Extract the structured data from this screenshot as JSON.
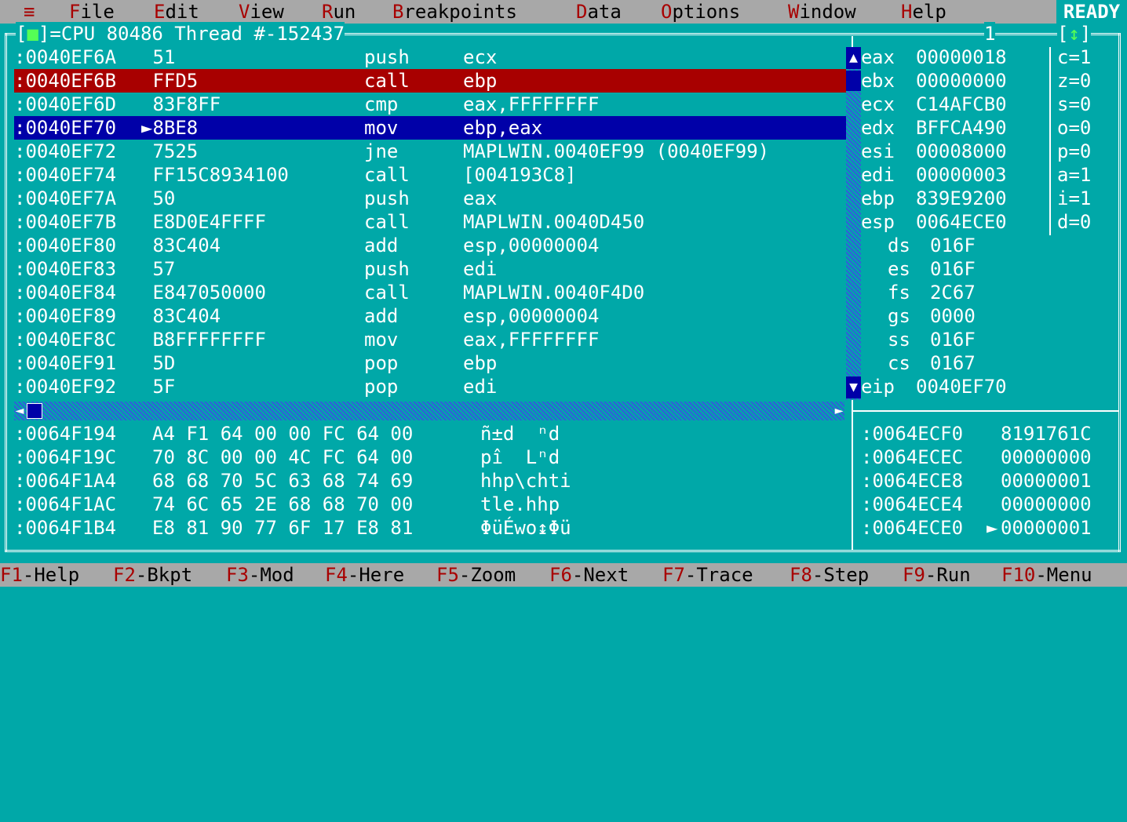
{
  "menu": {
    "system_icon": "≡",
    "items": [
      {
        "hot": "F",
        "rest": "ile"
      },
      {
        "hot": "E",
        "rest": "dit"
      },
      {
        "hot": "V",
        "rest": "iew"
      },
      {
        "hot": "R",
        "rest": "un"
      },
      {
        "hot": "B",
        "rest": "reakpoints"
      },
      {
        "hot": "D",
        "rest": "ata"
      },
      {
        "hot": "O",
        "rest": "ptions"
      },
      {
        "hot": "W",
        "rest": "indow"
      },
      {
        "hot": "H",
        "rest": "elp"
      }
    ],
    "status": "READY"
  },
  "window": {
    "close_box": "■",
    "title": "CPU 80486 Thread #-152437",
    "number": "1",
    "zoom_icon": "↕"
  },
  "code": [
    {
      "addr": ":0040EF6A",
      "bytes": " 51",
      "mnem": "push",
      "ops": "ecx"
    },
    {
      "addr": ":0040EF6B",
      "bytes": " FFD5",
      "mnem": "call",
      "ops": "ebp"
    },
    {
      "addr": ":0040EF6D",
      "bytes": " 83F8FF",
      "mnem": "cmp",
      "ops": "eax,FFFFFFFF"
    },
    {
      "addr": ":0040EF70",
      "bytes": "►8BE8",
      "mnem": "mov",
      "ops": "ebp,eax"
    },
    {
      "addr": ":0040EF72",
      "bytes": " 7525",
      "mnem": "jne",
      "ops": "MAPLWIN.0040EF99 (0040EF99)"
    },
    {
      "addr": ":0040EF74",
      "bytes": " FF15C8934100",
      "mnem": "call",
      "ops": "[004193C8]"
    },
    {
      "addr": ":0040EF7A",
      "bytes": " 50",
      "mnem": "push",
      "ops": "eax"
    },
    {
      "addr": ":0040EF7B",
      "bytes": " E8D0E4FFFF",
      "mnem": "call",
      "ops": "MAPLWIN.0040D450"
    },
    {
      "addr": ":0040EF80",
      "bytes": " 83C404",
      "mnem": "add",
      "ops": "esp,00000004"
    },
    {
      "addr": ":0040EF83",
      "bytes": " 57",
      "mnem": "push",
      "ops": "edi"
    },
    {
      "addr": ":0040EF84",
      "bytes": " E847050000",
      "mnem": "call",
      "ops": "MAPLWIN.0040F4D0"
    },
    {
      "addr": ":0040EF89",
      "bytes": " 83C404",
      "mnem": "add",
      "ops": "esp,00000004"
    },
    {
      "addr": ":0040EF8C",
      "bytes": " B8FFFFFFFF",
      "mnem": "mov",
      "ops": "eax,FFFFFFFF"
    },
    {
      "addr": ":0040EF91",
      "bytes": " 5D",
      "mnem": "pop",
      "ops": "ebp"
    },
    {
      "addr": ":0040EF92",
      "bytes": " 5F",
      "mnem": "pop",
      "ops": "edi"
    }
  ],
  "registers": [
    {
      "prefix": "e",
      "name": "ax",
      "value": "00000018"
    },
    {
      "prefix": "e",
      "name": "bx",
      "value": "00000000"
    },
    {
      "prefix": "e",
      "name": "cx",
      "value": "C14AFCB0"
    },
    {
      "prefix": "e",
      "name": "dx",
      "value": "BFFCA490"
    },
    {
      "prefix": "e",
      "name": "si",
      "value": "00008000"
    },
    {
      "prefix": "e",
      "name": "di",
      "value": "00000003"
    },
    {
      "prefix": "e",
      "name": "bp",
      "value": "839E9200"
    },
    {
      "prefix": "e",
      "name": "sp",
      "value": "0064ECE0"
    },
    {
      "prefix": "",
      "name": "ds",
      "value": "016F"
    },
    {
      "prefix": "",
      "name": "es",
      "value": "016F"
    },
    {
      "prefix": "",
      "name": "fs",
      "value": "2C67"
    },
    {
      "prefix": "",
      "name": "gs",
      "value": "0000"
    },
    {
      "prefix": "",
      "name": "ss",
      "value": "016F"
    },
    {
      "prefix": "",
      "name": "cs",
      "value": "0167"
    },
    {
      "prefix": "e",
      "name": "ip",
      "value": "0040EF70"
    }
  ],
  "flags": [
    "c=1",
    "z=0",
    "s=0",
    "o=0",
    "p=0",
    "a=1",
    "i=1",
    "d=0"
  ],
  "dump": [
    {
      "addr": ":0064F194",
      "hex": "A4 F1 64 00 00 FC 64 00",
      "ascii": "ñ±d  ⁿd"
    },
    {
      "addr": ":0064F19C",
      "hex": "70 8C 00 00 4C FC 64 00",
      "ascii": "pî  Lⁿd"
    },
    {
      "addr": ":0064F1A4",
      "hex": "68 68 70 5C 63 68 74 69",
      "ascii": "hhp\\chti"
    },
    {
      "addr": ":0064F1AC",
      "hex": "74 6C 65 2E 68 68 70 00",
      "ascii": "tle.hhp"
    },
    {
      "addr": ":0064F1B4",
      "hex": "E8 81 90 77 6F 17 E8 81",
      "ascii": "ΦüÉwo↨Φü"
    }
  ],
  "stack": [
    {
      "addr": ":0064ECF0",
      "sep": " ",
      "value": "8191761C"
    },
    {
      "addr": ":0064ECEC",
      "sep": " ",
      "value": "00000000"
    },
    {
      "addr": ":0064ECE8",
      "sep": " ",
      "value": "00000001"
    },
    {
      "addr": ":0064ECE4",
      "sep": " ",
      "value": "00000000"
    },
    {
      "addr": ":0064ECE0",
      "sep": "►",
      "value": "00000001"
    }
  ],
  "fkeys": [
    {
      "key": "F1",
      "label": "-Help"
    },
    {
      "key": "F2",
      "label": "-Bkpt"
    },
    {
      "key": "F3",
      "label": "-Mod"
    },
    {
      "key": "F4",
      "label": "-Here"
    },
    {
      "key": "F5",
      "label": "-Zoom"
    },
    {
      "key": "F6",
      "label": "-Next"
    },
    {
      "key": "F7",
      "label": "-Trace"
    },
    {
      "key": "F8",
      "label": "-Step"
    },
    {
      "key": "F9",
      "label": "-Run"
    },
    {
      "key": "F10",
      "label": "-Menu"
    }
  ],
  "colors": {
    "background": "#00A8A8",
    "menu_bg": "#A8A8A8",
    "hotkey": "#A80000",
    "selection_red": "#A80000",
    "selection_blue": "#0000A8",
    "close_box": "#55FF55"
  }
}
